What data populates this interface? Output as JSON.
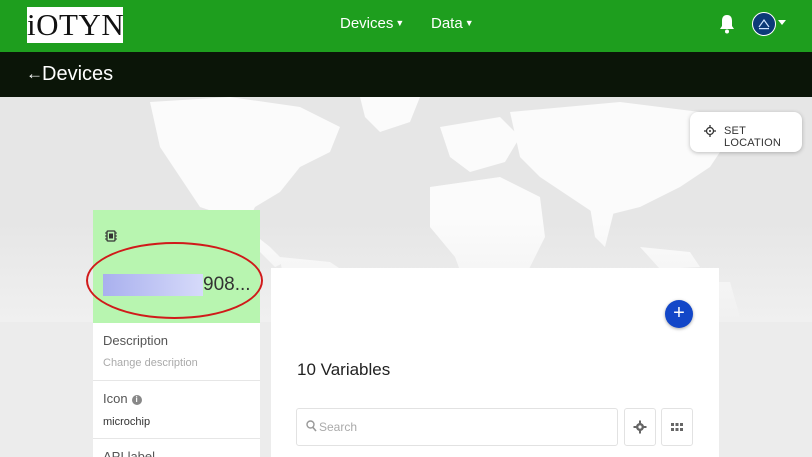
{
  "topnav": {
    "logo": "iOTYN",
    "menu": [
      {
        "label": "Devices"
      },
      {
        "label": "Data"
      }
    ],
    "bg_color": "#1e9e1e"
  },
  "titlebar": {
    "back_icon": "arrow-left-icon",
    "title": "Devices"
  },
  "map": {
    "set_location_label": "SET LOCATION",
    "set_location_icon": "crosshair-icon"
  },
  "device": {
    "icon": "microchip-icon",
    "name_suffix": "908...",
    "header_color": "#b8f5b0",
    "description_label": "Description",
    "description_placeholder": "Change description",
    "icon_label": "Icon",
    "icon_value": "microchip",
    "api_label": "API label"
  },
  "variables": {
    "title": "10 Variables",
    "search_placeholder": "Search",
    "add_button_color": "#1347c8"
  }
}
